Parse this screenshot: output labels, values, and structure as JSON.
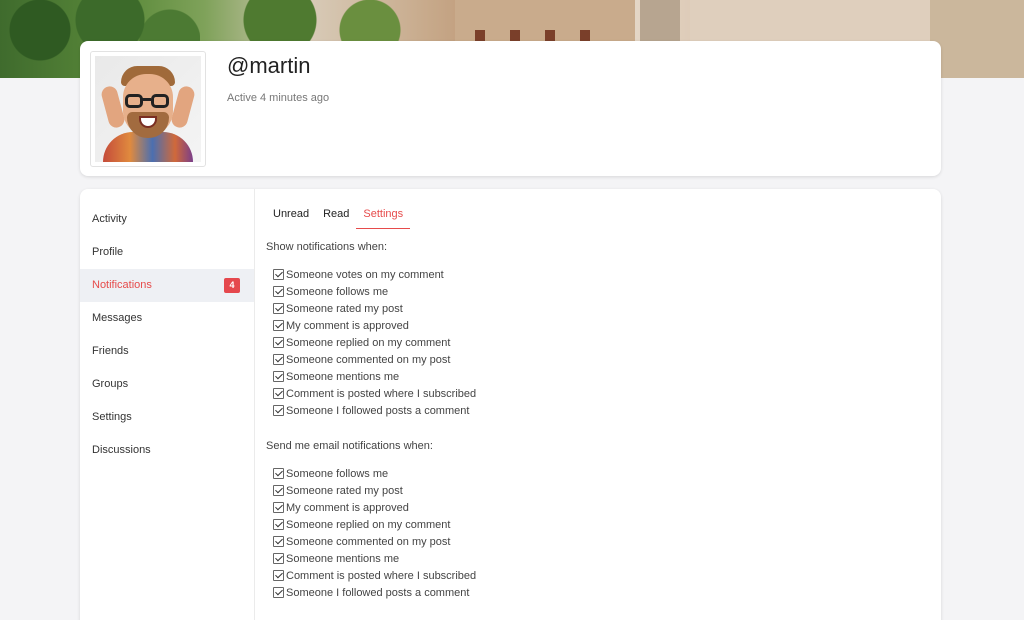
{
  "profile": {
    "username": "@martin",
    "status": "Active 4 minutes ago"
  },
  "sidebar": {
    "items": [
      {
        "label": "Activity"
      },
      {
        "label": "Profile"
      },
      {
        "label": "Notifications",
        "badge": "4",
        "active": true
      },
      {
        "label": "Messages"
      },
      {
        "label": "Friends"
      },
      {
        "label": "Groups"
      },
      {
        "label": "Settings"
      },
      {
        "label": "Discussions"
      }
    ]
  },
  "tabs": [
    {
      "label": "Unread"
    },
    {
      "label": "Read"
    },
    {
      "label": "Settings",
      "active": true
    }
  ],
  "show_section": {
    "title": "Show notifications when:",
    "options": [
      "Someone votes on my comment",
      "Someone follows me",
      "Someone rated my post",
      "My comment is approved",
      "Someone replied on my comment",
      "Someone commented on my post",
      "Someone mentions me",
      "Comment is posted where I subscribed",
      "Someone I followed posts a comment"
    ]
  },
  "email_section": {
    "title": "Send me email notifications when:",
    "options": [
      "Someone follows me",
      "Someone rated my post",
      "My comment is approved",
      "Someone replied on my comment",
      "Someone commented on my post",
      "Someone mentions me",
      "Comment is posted where I subscribed",
      "Someone I followed posts a comment"
    ]
  },
  "colors": {
    "accent": "#e64b4b",
    "badge": "#e5484d",
    "active_bg": "#eef0f4"
  }
}
